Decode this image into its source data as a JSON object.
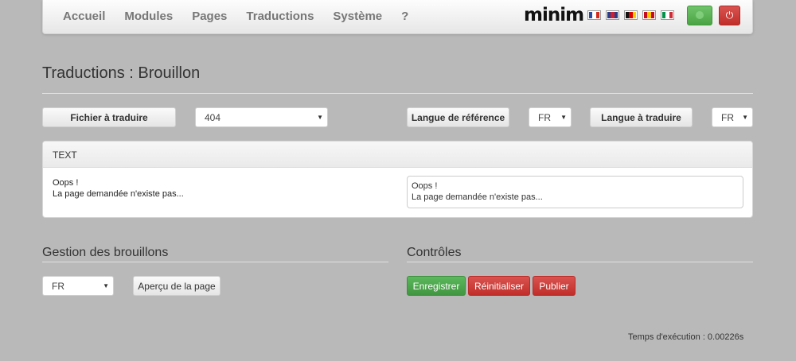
{
  "navbar": {
    "links": [
      "Accueil",
      "Modules",
      "Pages",
      "Traductions",
      "Système",
      "?"
    ],
    "brand": "minim",
    "flags": [
      {
        "name": "flag-fr-icon",
        "colors": [
          "#2b4ba0",
          "#ffffff",
          "#d52b1e"
        ]
      },
      {
        "name": "flag-uk-icon",
        "colors": [
          "#27408b",
          "#d22030",
          "#27408b"
        ]
      },
      {
        "name": "flag-de-icon",
        "colors": [
          "#111111",
          "#dd0000",
          "#ffce00"
        ]
      },
      {
        "name": "flag-es-icon",
        "colors": [
          "#c60b1e",
          "#ffc400",
          "#c60b1e"
        ]
      },
      {
        "name": "flag-it-icon",
        "colors": [
          "#009246",
          "#ffffff",
          "#ce2b37"
        ]
      }
    ],
    "power_icon": "⏻"
  },
  "page": {
    "title": "Traductions : Brouillon"
  },
  "controls": {
    "file_button": "Fichier à traduire",
    "file_select": "404",
    "ref_lang_button": "Langue de référence",
    "ref_lang_select": "FR",
    "target_lang_button": "Langue à traduire",
    "target_lang_select": "FR"
  },
  "panel": {
    "header": "TEXT",
    "source_text": "Oops !\nLa page demandée n'existe pas...",
    "translation_value": "Oops !\nLa page demandée n'existe pas..."
  },
  "drafts": {
    "title": "Gestion des brouillons",
    "lang_select": "FR",
    "preview_button": "Aperçu de la page"
  },
  "controls_section": {
    "title": "Contrôles",
    "save_button": "Enregistrer",
    "reset_button": "Réinitialiser",
    "publish_button": "Publier"
  },
  "footer": {
    "exec_time": "Temps d'exécution : 0.00226s"
  },
  "colors": {
    "background": "#b9b9b9",
    "success": "#5cb85c",
    "danger": "#d9534f"
  }
}
